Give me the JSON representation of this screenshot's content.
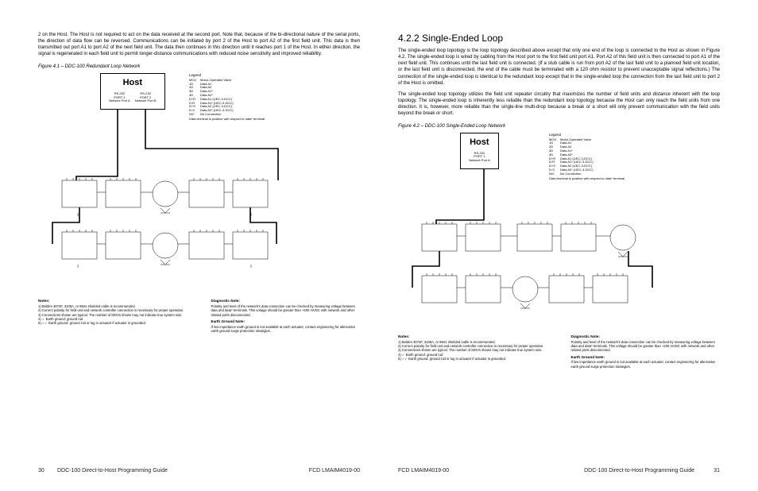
{
  "left": {
    "para1": "2 on the Host. The Host is not required to act on the data received at the second port. Note that, because of the bi-directional nature of the serial ports, the direction of data flow can be reversed. Communications can be initiated by port 2 of the Host to port A2 of the first field unit. This data is then transmitted out port A1 to port A2 of the next field unit. The data then continues in this direction until it reaches port 1 of the Host. In either direction, the signal is regenerated in each field unit to permit longer-distance communications with reduced noise sensitivity and improved reliability.",
    "figcaption": "Figure 4.1 – DDC-100 Redundant Loop Network",
    "host": {
      "title": "Host",
      "port1a": "RS-232",
      "port1b": "PORT 1",
      "port1c": "Network Port  A",
      "port2a": "RS-232",
      "port2b": "PORT 2",
      "port2c": "Network Port  B"
    },
    "legend": {
      "title": "Legend",
      "rows": [
        {
          "k": "MOV",
          "v": "Motor-Operated Valve"
        },
        {
          "k": "1D",
          "v": "Data A1"
        },
        {
          "k": "2D",
          "v": "Data A2"
        },
        {
          "k": "3D",
          "v": "Data A1*"
        },
        {
          "k": "4D",
          "v": "Data A2*"
        },
        {
          "k": "D+R",
          "v": "Data A1 (UEC-3-DCC)"
        },
        {
          "k": "D-R",
          "v": "Data A1* (UEC-3-DCC)"
        },
        {
          "k": "D+S",
          "v": "Data A2 (UEC-3-DCC)"
        },
        {
          "k": "D-S",
          "v": "Data A2* (UEC-3-DCC)"
        },
        {
          "k": "N/C",
          "v": "No Connection"
        }
      ],
      "foot": "Data terminal is positive with respect to data* terminal"
    },
    "notes": {
      "title": "Notes:",
      "items": [
        "Belden 3074F, 3105A, or 9841 shielded cable is recommended.",
        "Correct polarity for field unit and network controller connection is necessary for proper operation.",
        "Connections shown are typical. The number of MOVs shown may not indicate true system size.",
        "✓ Earth ground: ground rod",
        "✓✓ Earth ground: ground rod or lug in actuator if actuator is grounded."
      ]
    },
    "diag": {
      "title": "Diagnostic Note:",
      "body": "Polarity and level of the network's data connection can be checked by measuring voltage between data and data* terminals. This voltage should be greater than +200 mVDC with network and other related ports disconnected."
    },
    "earth": {
      "title": "Earth Ground Note:",
      "body": "If low impedance earth ground is not available at each actuator, contact engineering for alternative earth ground surge protection strategies."
    }
  },
  "right": {
    "heading": "4.2.2  Single-Ended Loop",
    "para1": "The single-ended loop topology is the loop topology described above except that only one end of the loop is connected to the Host as shown in Figure 4.2. The single-ended loop is wired by cabling from the Host port to the first field unit port A1. Port A2 of this field unit is then connected to port A1 of the next field unit. This continues until the last field unit is connected. (If a stub cable is run from port A2 of the last field unit to a planned field unit location, or the last field unit is disconnected, the end of the cable must be terminated with a 120 ohm resistor to prevent unacceptable signal reflections.) The connection of the single-ended loop is identical to the redundant loop except that in the single-ended loop the connection from the last field unit to port 2 of the Host is omitted.",
    "para2": "The single-ended loop topology utilizes the field unit repeater circuitry that maximizes the number of field units and distance inherent with the loop topology. The single-ended loop is inherently less reliable than the redundant loop topology because the Host can only reach the field units from one direction. It is, however, more reliable than the single-line multi-drop because a break or a short will only prevent communication with the field units beyond the break or short.",
    "figcaption": "Figure 4.2 – DDC-100 Single-Ended Loop Network",
    "host": {
      "title": "Host",
      "port1a": "RS-232",
      "port1b": "PORT 1",
      "port1c": "Network Port  A"
    }
  },
  "footer": {
    "left_no": "30",
    "right_no": "31",
    "guide": "DDC-100 Direct-to-Host Programming Guide",
    "fcd": "FCD LMAIM4019-00"
  }
}
